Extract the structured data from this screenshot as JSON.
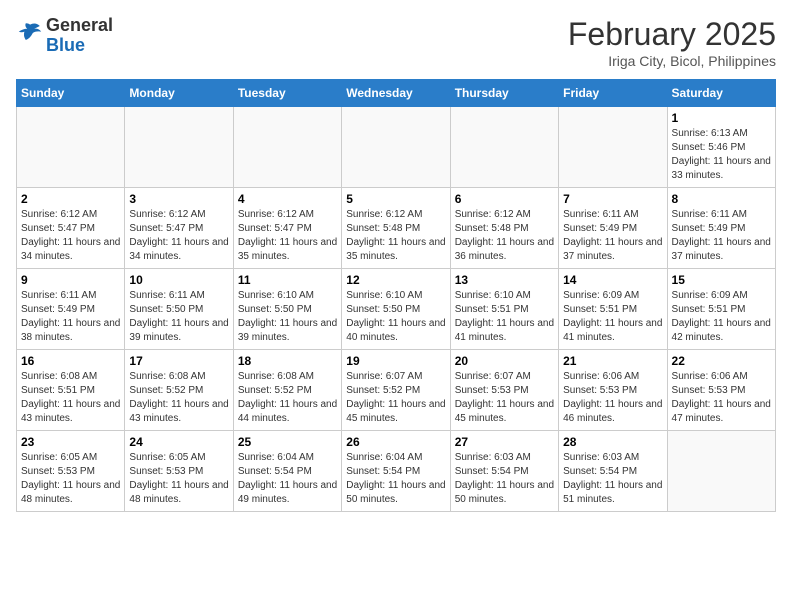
{
  "header": {
    "logo_general": "General",
    "logo_blue": "Blue",
    "month_year": "February 2025",
    "location": "Iriga City, Bicol, Philippines"
  },
  "days_of_week": [
    "Sunday",
    "Monday",
    "Tuesday",
    "Wednesday",
    "Thursday",
    "Friday",
    "Saturday"
  ],
  "weeks": [
    [
      {
        "day": "",
        "info": ""
      },
      {
        "day": "",
        "info": ""
      },
      {
        "day": "",
        "info": ""
      },
      {
        "day": "",
        "info": ""
      },
      {
        "day": "",
        "info": ""
      },
      {
        "day": "",
        "info": ""
      },
      {
        "day": "1",
        "info": "Sunrise: 6:13 AM\nSunset: 5:46 PM\nDaylight: 11 hours and 33 minutes."
      }
    ],
    [
      {
        "day": "2",
        "info": "Sunrise: 6:12 AM\nSunset: 5:47 PM\nDaylight: 11 hours and 34 minutes."
      },
      {
        "day": "3",
        "info": "Sunrise: 6:12 AM\nSunset: 5:47 PM\nDaylight: 11 hours and 34 minutes."
      },
      {
        "day": "4",
        "info": "Sunrise: 6:12 AM\nSunset: 5:47 PM\nDaylight: 11 hours and 35 minutes."
      },
      {
        "day": "5",
        "info": "Sunrise: 6:12 AM\nSunset: 5:48 PM\nDaylight: 11 hours and 35 minutes."
      },
      {
        "day": "6",
        "info": "Sunrise: 6:12 AM\nSunset: 5:48 PM\nDaylight: 11 hours and 36 minutes."
      },
      {
        "day": "7",
        "info": "Sunrise: 6:11 AM\nSunset: 5:49 PM\nDaylight: 11 hours and 37 minutes."
      },
      {
        "day": "8",
        "info": "Sunrise: 6:11 AM\nSunset: 5:49 PM\nDaylight: 11 hours and 37 minutes."
      }
    ],
    [
      {
        "day": "9",
        "info": "Sunrise: 6:11 AM\nSunset: 5:49 PM\nDaylight: 11 hours and 38 minutes."
      },
      {
        "day": "10",
        "info": "Sunrise: 6:11 AM\nSunset: 5:50 PM\nDaylight: 11 hours and 39 minutes."
      },
      {
        "day": "11",
        "info": "Sunrise: 6:10 AM\nSunset: 5:50 PM\nDaylight: 11 hours and 39 minutes."
      },
      {
        "day": "12",
        "info": "Sunrise: 6:10 AM\nSunset: 5:50 PM\nDaylight: 11 hours and 40 minutes."
      },
      {
        "day": "13",
        "info": "Sunrise: 6:10 AM\nSunset: 5:51 PM\nDaylight: 11 hours and 41 minutes."
      },
      {
        "day": "14",
        "info": "Sunrise: 6:09 AM\nSunset: 5:51 PM\nDaylight: 11 hours and 41 minutes."
      },
      {
        "day": "15",
        "info": "Sunrise: 6:09 AM\nSunset: 5:51 PM\nDaylight: 11 hours and 42 minutes."
      }
    ],
    [
      {
        "day": "16",
        "info": "Sunrise: 6:08 AM\nSunset: 5:51 PM\nDaylight: 11 hours and 43 minutes."
      },
      {
        "day": "17",
        "info": "Sunrise: 6:08 AM\nSunset: 5:52 PM\nDaylight: 11 hours and 43 minutes."
      },
      {
        "day": "18",
        "info": "Sunrise: 6:08 AM\nSunset: 5:52 PM\nDaylight: 11 hours and 44 minutes."
      },
      {
        "day": "19",
        "info": "Sunrise: 6:07 AM\nSunset: 5:52 PM\nDaylight: 11 hours and 45 minutes."
      },
      {
        "day": "20",
        "info": "Sunrise: 6:07 AM\nSunset: 5:53 PM\nDaylight: 11 hours and 45 minutes."
      },
      {
        "day": "21",
        "info": "Sunrise: 6:06 AM\nSunset: 5:53 PM\nDaylight: 11 hours and 46 minutes."
      },
      {
        "day": "22",
        "info": "Sunrise: 6:06 AM\nSunset: 5:53 PM\nDaylight: 11 hours and 47 minutes."
      }
    ],
    [
      {
        "day": "23",
        "info": "Sunrise: 6:05 AM\nSunset: 5:53 PM\nDaylight: 11 hours and 48 minutes."
      },
      {
        "day": "24",
        "info": "Sunrise: 6:05 AM\nSunset: 5:53 PM\nDaylight: 11 hours and 48 minutes."
      },
      {
        "day": "25",
        "info": "Sunrise: 6:04 AM\nSunset: 5:54 PM\nDaylight: 11 hours and 49 minutes."
      },
      {
        "day": "26",
        "info": "Sunrise: 6:04 AM\nSunset: 5:54 PM\nDaylight: 11 hours and 50 minutes."
      },
      {
        "day": "27",
        "info": "Sunrise: 6:03 AM\nSunset: 5:54 PM\nDaylight: 11 hours and 50 minutes."
      },
      {
        "day": "28",
        "info": "Sunrise: 6:03 AM\nSunset: 5:54 PM\nDaylight: 11 hours and 51 minutes."
      },
      {
        "day": "",
        "info": ""
      }
    ]
  ]
}
